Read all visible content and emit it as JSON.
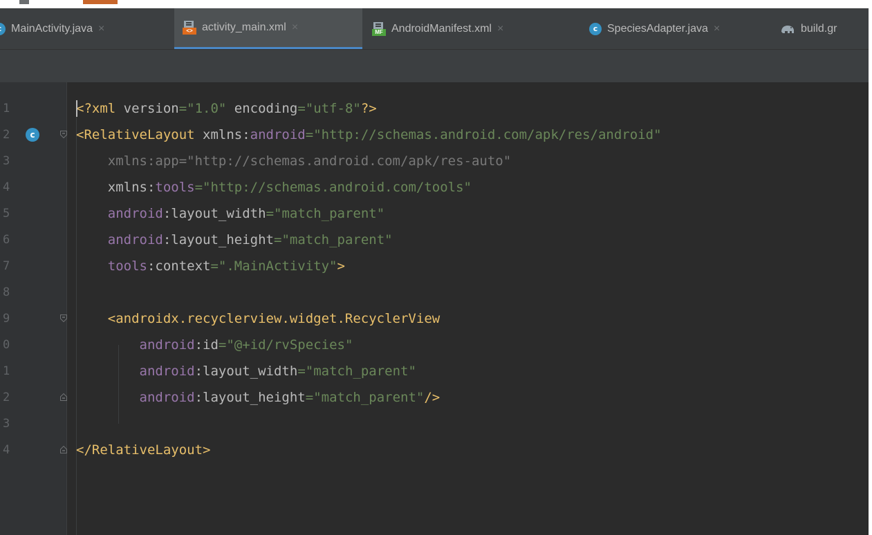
{
  "window": {
    "title": "activity_main.xml"
  },
  "colors": {
    "editor_bg": "#2b2b2b",
    "gutter_bg": "#313335",
    "tab_bar_bg": "#3c3f41",
    "active_tab_underline": "#4a88c7",
    "xml_tag": "#e8bf6a",
    "namespace": "#9876aa",
    "string": "#6a8759"
  },
  "tabs": [
    {
      "label": "MainActivity.java",
      "icon": "java-class-icon",
      "active": false
    },
    {
      "label": "activity_main.xml",
      "icon": "xml-layout-icon",
      "active": true
    },
    {
      "label": "AndroidManifest.xml",
      "icon": "manifest-icon",
      "active": false
    },
    {
      "label": "SpeciesAdapter.java",
      "icon": "java-class-icon",
      "active": false
    },
    {
      "label": "build.gr",
      "icon": "gradle-elephant-icon",
      "active": false
    }
  ],
  "close_glyph": "×",
  "gutter_class_marker": "c",
  "editor": {
    "lines": [
      {
        "num": "1",
        "tokens": [
          [
            "t",
            "<?xml "
          ],
          [
            "at",
            "version"
          ],
          [
            "s",
            "=\"1.0\" "
          ],
          [
            "at",
            "encoding"
          ],
          [
            "s",
            "=\"utf-8\""
          ],
          [
            "t",
            "?>"
          ]
        ]
      },
      {
        "num": "2",
        "tokens": [
          [
            "t",
            "<RelativeLayout "
          ],
          [
            "at",
            "xmlns:"
          ],
          [
            "ns",
            "android"
          ],
          [
            "s",
            "=\"http://schemas.android.com/apk/res/android\""
          ]
        ]
      },
      {
        "num": "3",
        "tokens": [
          [
            "dim",
            "    xmlns:app=\"http://schemas.android.com/apk/res-auto\""
          ]
        ]
      },
      {
        "num": "4",
        "tokens": [
          [
            "at",
            "    xmlns:"
          ],
          [
            "ns",
            "tools"
          ],
          [
            "s",
            "=\"http://schemas.android.com/tools\""
          ]
        ]
      },
      {
        "num": "5",
        "tokens": [
          [
            "ns",
            "    android"
          ],
          [
            "at",
            ":layout_width"
          ],
          [
            "s",
            "=\"match_parent\""
          ]
        ]
      },
      {
        "num": "6",
        "tokens": [
          [
            "ns",
            "    android"
          ],
          [
            "at",
            ":layout_height"
          ],
          [
            "s",
            "=\"match_parent\""
          ]
        ]
      },
      {
        "num": "7",
        "tokens": [
          [
            "ns",
            "    tools"
          ],
          [
            "at",
            ":context"
          ],
          [
            "s",
            "=\".MainActivity\""
          ],
          [
            "t",
            ">"
          ]
        ]
      },
      {
        "num": "8",
        "tokens": []
      },
      {
        "num": "9",
        "tokens": [
          [
            "t",
            "    <androidx.recyclerview.widget.RecyclerView"
          ]
        ]
      },
      {
        "num": "0",
        "tokens": [
          [
            "ns",
            "        android"
          ],
          [
            "at",
            ":id"
          ],
          [
            "s",
            "=\"@+id/rvSpecies\""
          ]
        ]
      },
      {
        "num": "1",
        "tokens": [
          [
            "ns",
            "        android"
          ],
          [
            "at",
            ":layout_width"
          ],
          [
            "s",
            "=\"match_parent\""
          ]
        ]
      },
      {
        "num": "2",
        "tokens": [
          [
            "ns",
            "        android"
          ],
          [
            "at",
            ":layout_height"
          ],
          [
            "s",
            "=\"match_parent\""
          ],
          [
            "t",
            "/>"
          ]
        ]
      },
      {
        "num": "3",
        "tokens": []
      },
      {
        "num": "4",
        "tokens": [
          [
            "t",
            "</RelativeLayout>"
          ]
        ]
      }
    ]
  }
}
